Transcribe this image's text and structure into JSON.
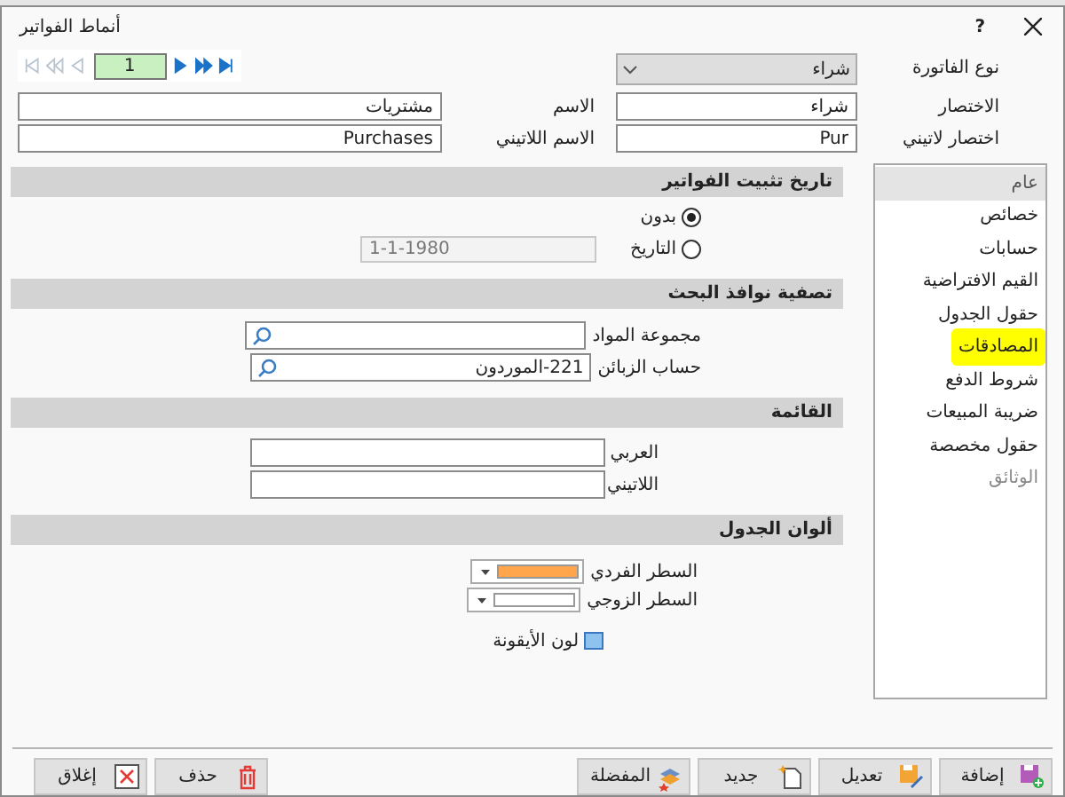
{
  "window": {
    "title": "أنماط الفواتير",
    "help": "?"
  },
  "navigator": {
    "record": "1",
    "buttons": [
      {
        "kind": "first",
        "enabled": false
      },
      {
        "kind": "rewind",
        "enabled": false
      },
      {
        "kind": "previous",
        "enabled": false
      },
      {
        "kind": "next",
        "enabled": true
      },
      {
        "kind": "forward",
        "enabled": true
      },
      {
        "kind": "last",
        "enabled": true
      }
    ]
  },
  "header_fields": {
    "invoice_type": {
      "label": "نوع الفاتورة",
      "value": "شراء"
    },
    "abbreviation": {
      "label": "الاختصار",
      "value": "شراء"
    },
    "name": {
      "label": "الاسم",
      "value": "مشتريات"
    },
    "latin_abbreviation": {
      "label": "اختصار لاتيني",
      "value": "Pur"
    },
    "latin_name": {
      "label": "الاسم اللاتيني",
      "value": "Purchases"
    }
  },
  "sidebar": {
    "items": [
      {
        "label": "عام",
        "selected": true,
        "highlighted": false,
        "disabled": false
      },
      {
        "label": "خصائص",
        "selected": false,
        "highlighted": false,
        "disabled": false
      },
      {
        "label": "حسابات",
        "selected": false,
        "highlighted": false,
        "disabled": false
      },
      {
        "label": "القيم الافتراضية",
        "selected": false,
        "highlighted": false,
        "disabled": false
      },
      {
        "label": "حقول الجدول",
        "selected": false,
        "highlighted": false,
        "disabled": false
      },
      {
        "label": "المصادقات",
        "selected": false,
        "highlighted": true,
        "disabled": false
      },
      {
        "label": "شروط الدفع",
        "selected": false,
        "highlighted": false,
        "disabled": false
      },
      {
        "label": "ضريبة المبيعات",
        "selected": false,
        "highlighted": false,
        "disabled": false
      },
      {
        "label": "حقول مخصصة",
        "selected": false,
        "highlighted": false,
        "disabled": false
      },
      {
        "label": "الوثائق",
        "selected": false,
        "highlighted": false,
        "disabled": true
      }
    ]
  },
  "sections": [
    {
      "kind": "date_radio",
      "title": "تاريخ تثبيت الفواتير",
      "options": [
        {
          "label": "بدون",
          "selected": true
        },
        {
          "label": "التاريخ",
          "selected": false
        }
      ],
      "date": "1-1-1980"
    },
    {
      "kind": "search_fields",
      "title": "تصفية نوافذ البحث",
      "fields": [
        {
          "label": "مجموعة المواد"
        },
        {
          "label": "حساب الزبائن",
          "value": "221-الموردون"
        }
      ]
    },
    {
      "kind": "text_fields",
      "title": "القائمة",
      "fields": [
        {
          "label": "العربي"
        },
        {
          "label": "اللاتيني"
        }
      ]
    },
    {
      "kind": "colors",
      "title": "ألوان الجدول",
      "rows": [
        {
          "label": "السطر الفردي",
          "color": "#ffa64d"
        },
        {
          "label": "السطر الزوجي",
          "color": "#ffffff"
        }
      ],
      "icon_color": {
        "label": "لون الأيقونة",
        "color": "#8ec3ef"
      }
    }
  ],
  "buttons": [
    {
      "kind": "add",
      "label": "إضافة"
    },
    {
      "kind": "edit",
      "label": "تعديل"
    },
    {
      "kind": "new",
      "label": "جديد"
    },
    {
      "kind": "favorites",
      "label": "المفضلة"
    },
    {
      "kind": "delete",
      "label": "حذف"
    },
    {
      "kind": "close",
      "label": "إغلاق"
    }
  ]
}
